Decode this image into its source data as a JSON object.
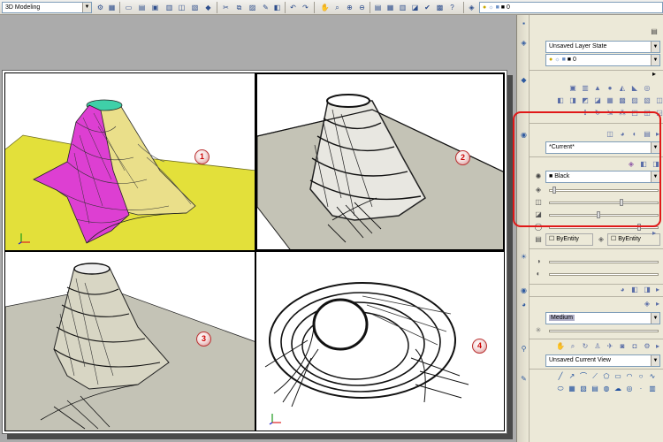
{
  "toolbar": {
    "workspace": "3D Modeling",
    "layer_value": "0"
  },
  "viewports": [
    {
      "number": "1",
      "style": "realistic-colored"
    },
    {
      "number": "2",
      "style": "hidden-shaded"
    },
    {
      "number": "3",
      "style": "shaded-gray"
    },
    {
      "number": "4",
      "style": "wireframe-hidden"
    }
  ],
  "palette": {
    "layer_state": "Unsaved Layer State",
    "layer_name": "0",
    "visual_style": "*Current*",
    "color": "Black",
    "linetype": "ByEntity",
    "lineweight": "ByEntity",
    "material": "Medium",
    "named_view": "Unsaved Current View"
  },
  "colors": {
    "highlight": "#e01818",
    "vp1_floor": "#e3e03a",
    "vp1_surface_magenta": "#dd3fd2",
    "vp1_cone": "#eadf8a",
    "vp1_top": "#3fd0a8",
    "gray_floor": "#c4c3b6"
  },
  "icons": [
    "new-icon",
    "open-icon",
    "save-icon",
    "plot-icon",
    "cut-icon",
    "copy-icon",
    "paste-icon",
    "match-icon",
    "undo-icon",
    "redo-icon",
    "pan-icon",
    "zoom-icon",
    "properties-icon",
    "layer-icon",
    "sun-icon",
    "render-icon",
    "camera-icon",
    "ucs-icon",
    "line-icon",
    "arc-icon",
    "circle-icon"
  ]
}
